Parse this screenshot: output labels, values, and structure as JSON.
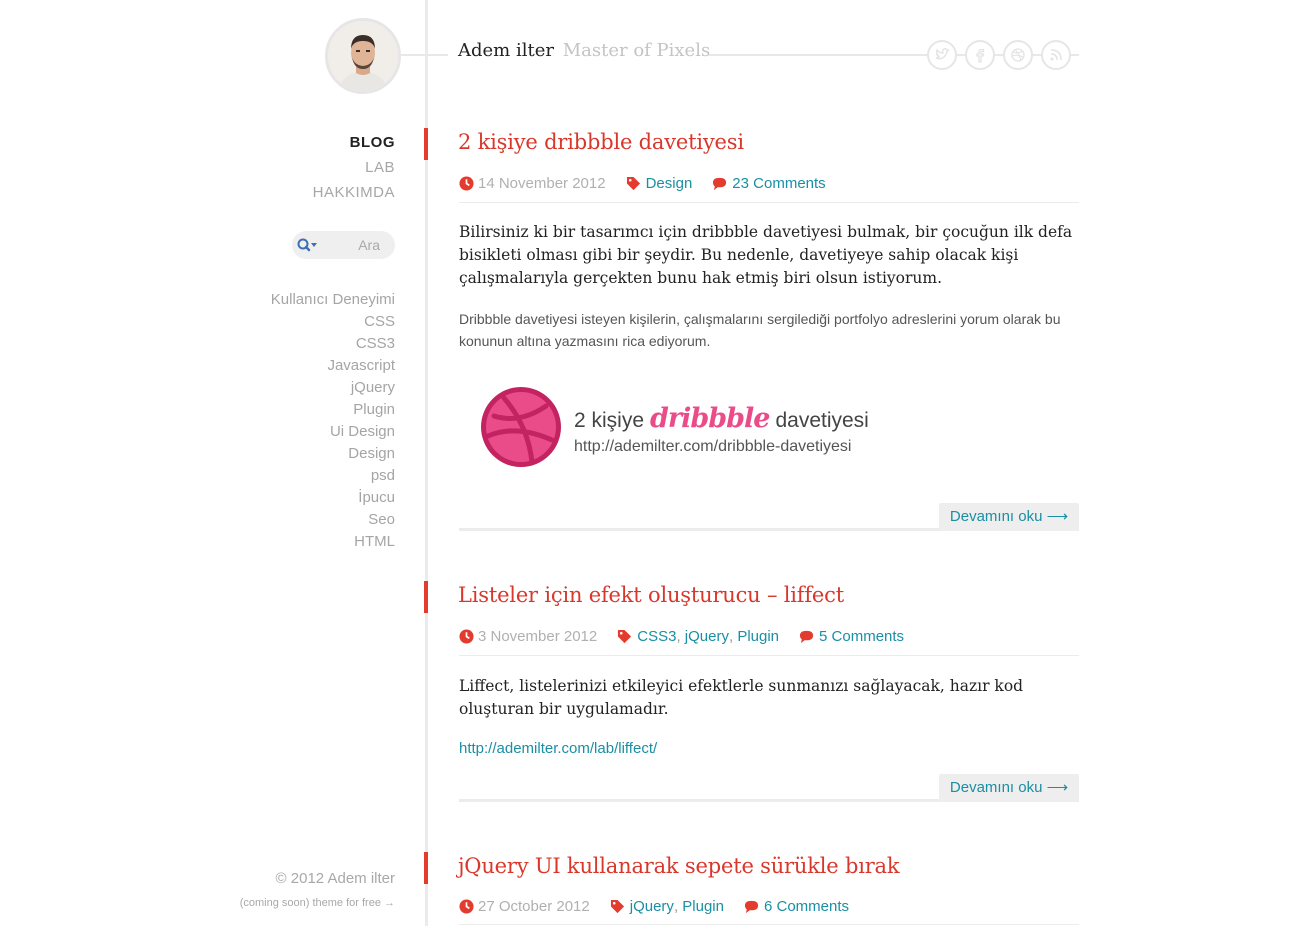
{
  "site": {
    "name": "Adem ilter",
    "tagline": "Master of Pixels"
  },
  "social_icons": [
    "twitter-icon",
    "facebook-icon",
    "dribbble-icon",
    "rss-icon"
  ],
  "nav": [
    {
      "label": "BLOG",
      "active": true
    },
    {
      "label": "LAB",
      "active": false
    },
    {
      "label": "HAKKIMDA",
      "active": false
    }
  ],
  "search": {
    "placeholder": "Ara"
  },
  "categories": [
    "Kullanıcı Deneyimi",
    "CSS",
    "CSS3",
    "Javascript",
    "jQuery",
    "Plugin",
    "Ui Design",
    "Design",
    "psd",
    "İpucu",
    "Seo",
    "HTML"
  ],
  "footer": {
    "copyright": "© 2012 Adem ilter",
    "theme": "(coming soon) theme for free →"
  },
  "colors": {
    "accent": "#e33b2e",
    "link": "#1a8fa4",
    "dribbble": "#ea4c89"
  },
  "posts": [
    {
      "title": "2 kişiye dribbble davetiyesi",
      "date": "14 November 2012",
      "tags": [
        "Design"
      ],
      "comments": "23 Comments",
      "lead": "Bilirsiniz ki bir tasarımcı için dribbble davetiyesi bulmak, bir çocuğun ilk defa bisikleti olması gibi bir şeydir. Bu nedenle, davetiyeye sahip olacak kişi çalışmalarıyla gerçekten bunu hak etmiş biri olsun istiyorum.",
      "body": "Dribbble davetiyesi isteyen kişilerin, çalışmalarını sergilediği portfolyo adreslerini yorum olarak bu konunun altına yazmasını rica ediyorum.",
      "banner": {
        "pre": "2 kişiye",
        "brand": "dribbble",
        "post": "davetiyesi",
        "url": "http://ademilter.com/dribbble-davetiyesi"
      },
      "more": "Devamını oku ⟶"
    },
    {
      "title": "Listeler için efekt oluşturucu – liffect",
      "date": "3 November 2012",
      "tags": [
        "CSS3",
        "jQuery",
        "Plugin"
      ],
      "comments": "5 Comments",
      "lead": "Liffect, listelerinizi etkileyici efektlerle sunmanızı sağlayacak, hazır kod oluşturan bir uygulamadır.",
      "link": "http://ademilter.com/lab/liffect/",
      "more": "Devamını oku ⟶"
    },
    {
      "title": "jQuery UI kullanarak sepete sürükle bırak",
      "date": "27 October 2012",
      "tags": [
        "jQuery",
        "Plugin"
      ],
      "comments": "6 Comments"
    }
  ]
}
